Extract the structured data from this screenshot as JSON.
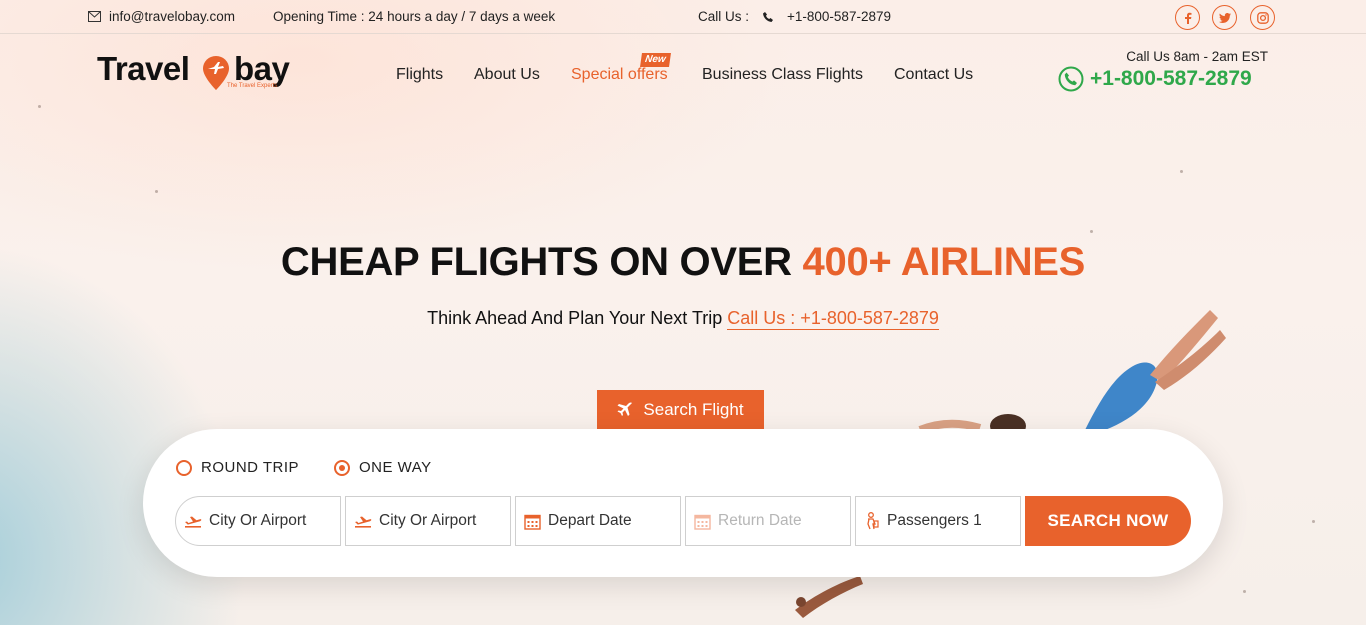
{
  "topbar": {
    "email": "info@travelobay.com",
    "opening_time": "Opening Time : 24 hours a day / 7 days a week",
    "call_label": "Call Us :",
    "phone": "+1-800-587-2879",
    "social": [
      "facebook-icon",
      "twitter-icon",
      "instagram-icon"
    ]
  },
  "header": {
    "logo_left": "Travel",
    "logo_right": "bay",
    "logo_tagline": "The Travel Experts",
    "nav": {
      "flights": "Flights",
      "about": "About Us",
      "special": "Special offers",
      "business": "Business Class Flights",
      "contact": "Contact Us"
    },
    "new_badge": "New",
    "call_hours": "Call Us 8am - 2am EST",
    "phone": "+1-800-587-2879"
  },
  "hero": {
    "title_main": "CHEAP FLIGHTS ON OVER",
    "title_accent": "400+ AIRLINES",
    "subtitle": "Think Ahead And Plan Your Next Trip",
    "subtitle_link": "Call Us : +1-800-587-2879"
  },
  "search": {
    "tab_label": "Search Flight",
    "trip_types": {
      "round": "ROUND TRIP",
      "oneway": "ONE WAY",
      "selected": "ONE WAY"
    },
    "from_placeholder": "City Or Airport",
    "to_placeholder": "City Or Airport",
    "depart_placeholder": "Depart Date",
    "return_placeholder": "Return Date",
    "passengers": "Passengers 1",
    "button": "SEARCH NOW"
  },
  "colors": {
    "accent": "#e8622c",
    "phone_green": "#2fa84a"
  }
}
